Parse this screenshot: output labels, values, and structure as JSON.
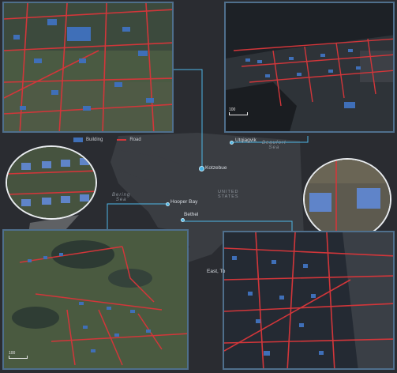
{
  "legend": {
    "building_label": "Building",
    "road_label": "Road",
    "building_color": "#3f6fb8",
    "road_color": "#d2363a"
  },
  "places": {
    "kotzebue": "Kotzebue",
    "utqiagvik": "Utqiagvik",
    "hooper_bay": "Hooper Bay",
    "bethel": "Bethel",
    "east_label": "East, To"
  },
  "regions": {
    "beaufort_sea_line1": "Beaufort",
    "beaufort_sea_line2": "Sea",
    "bering_sea_line1": "Bering",
    "bering_sea_line2": "Sea",
    "united_states_line1": "UNITED",
    "united_states_line2": "STATES"
  },
  "scales": {
    "top_right": "100",
    "bottom_left": "100"
  },
  "colors": {
    "background": "#2a2c31",
    "land": "#3a3d42",
    "panel_border": "#4f6f8c",
    "connector": "#4fb6e6"
  }
}
